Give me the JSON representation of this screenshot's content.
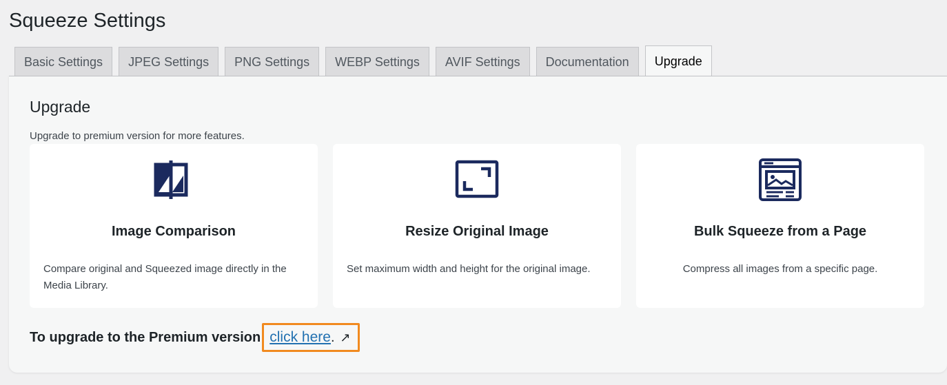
{
  "page": {
    "title": "Squeeze Settings"
  },
  "tabs": [
    {
      "label": "Basic Settings"
    },
    {
      "label": "JPEG Settings"
    },
    {
      "label": "PNG Settings"
    },
    {
      "label": "WEBP Settings"
    },
    {
      "label": "AVIF Settings"
    },
    {
      "label": "Documentation"
    },
    {
      "label": "Upgrade"
    }
  ],
  "active_tab": "Upgrade",
  "section": {
    "title": "Upgrade",
    "description": "Upgrade to premium version for more features."
  },
  "cards": [
    {
      "icon": "image-comparison-icon",
      "title": "Image Comparison",
      "text": "Compare original and Squeezed image directly in the Media Library."
    },
    {
      "icon": "resize-icon",
      "title": "Resize Original Image",
      "text": "Set maximum width and height for the original image."
    },
    {
      "icon": "bulk-page-icon",
      "title": "Bulk Squeeze from a Page",
      "text": "Compress all images from a specific page."
    }
  ],
  "upgrade": {
    "lead": "To upgrade to the Premium version",
    "link_text": "click here",
    "suffix": ".",
    "external_glyph": "↗"
  },
  "colors": {
    "icon": "#1b2a5e",
    "link": "#2271b1",
    "highlight": "#f18a1f"
  }
}
